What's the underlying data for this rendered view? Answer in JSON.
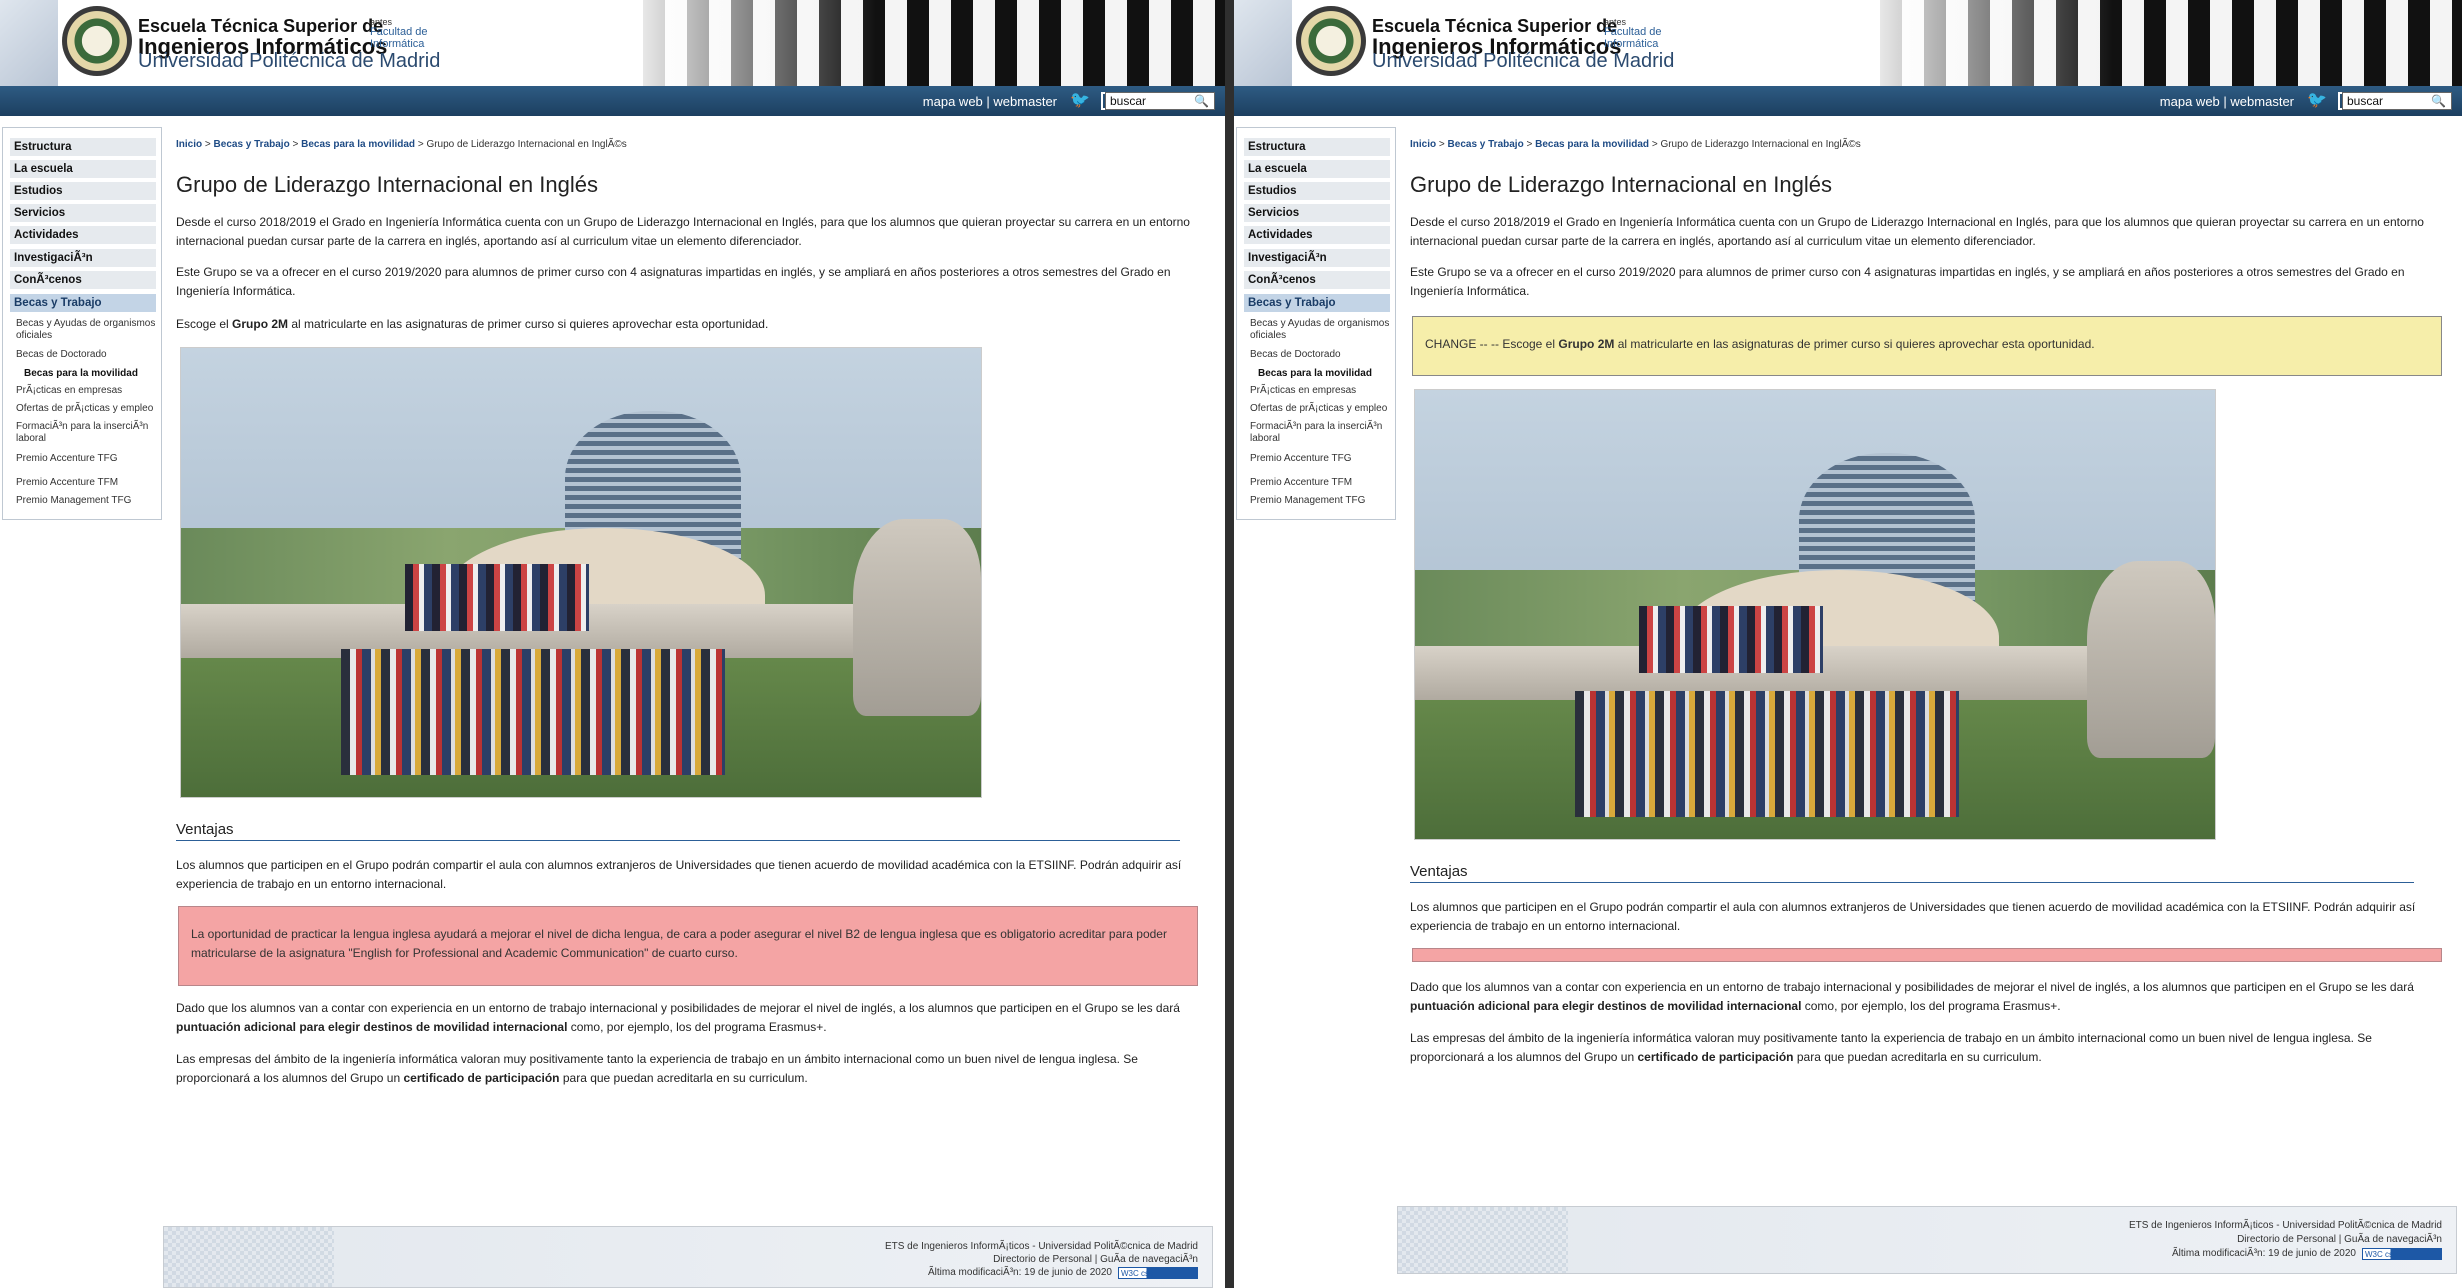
{
  "header": {
    "school_line1": "Escuela Técnica Superior de",
    "school_line2": "Ingenieros Informáticos",
    "university": "Universidad Politécnica de Madrid",
    "antes": "antes",
    "facultad_line1": "Facultad de",
    "facultad_line2": "Informática"
  },
  "topbar": {
    "mapa_web": "mapa web",
    "separator": "|",
    "webmaster": "webmaster",
    "search_value": "buscar"
  },
  "sidebar": {
    "items": [
      {
        "label": "Estructura"
      },
      {
        "label": "La escuela"
      },
      {
        "label": "Estudios"
      },
      {
        "label": "Servicios"
      },
      {
        "label": "Actividades"
      },
      {
        "label": "InvestigaciÃ³n"
      },
      {
        "label": "ConÃ³cenos"
      },
      {
        "label": "Becas y Trabajo"
      }
    ],
    "subitems": [
      {
        "label": "Becas y Ayudas de organismos oficiales"
      },
      {
        "label": "Becas de Doctorado"
      },
      {
        "label": "Becas para la movilidad"
      },
      {
        "label": "PrÃ¡cticas en empresas"
      },
      {
        "label": "Ofertas de prÃ¡cticas y empleo"
      },
      {
        "label": "FormaciÃ³n para la inserciÃ³n laboral"
      },
      {
        "label": "Premio Accenture TFG"
      },
      {
        "label": "Premio Accenture TFM"
      },
      {
        "label": "Premio Management TFG"
      }
    ]
  },
  "breadcrumb": {
    "inicio": "Inicio",
    "sep": ">",
    "becas_trabajo": "Becas y Trabajo",
    "becas_movilidad": "Becas para la movilidad",
    "current": "Grupo de Liderazgo Internacional en InglÃ©s"
  },
  "main": {
    "title": "Grupo de Liderazgo Internacional en Inglés",
    "p1": "Desde el curso 2018/2019 el Grado en Ingeniería Informática cuenta con un Grupo de Liderazgo Internacional en Inglés, para que los alumnos que quieran proyectar su carrera en un entorno internacional puedan cursar parte de la carrera en inglés,  aportando así al curriculum vitae un elemento diferenciador.",
    "p2": "Este Grupo se va a ofrecer en el curso 2019/2020 para alumnos de primer curso con 4 asignaturas impartidas en inglés, y se ampliará en años posteriores a otros semestres del Grado en Ingeniería Informática.",
    "p3_before": "Escoge el ",
    "p3_bold": "Grupo 2M",
    "p3_after": " al matricularte en las asignaturas de primer curso si quieres aprovechar esta oportunidad.",
    "change_prefix": "CHANGE -- -- Escoge el ",
    "ventajas": "Ventajas",
    "p4": "Los alumnos que participen en el Grupo podrán compartir el aula con alumnos extranjeros de Universidades que tienen acuerdo de movilidad académica con la ETSIINF. Podrán adquirir así experiencia de trabajo en un entorno internacional.",
    "red_box": "La oportunidad de practicar la lengua inglesa ayudará a mejorar el nivel de dicha lengua, de cara a poder asegurar el nivel B2 de lengua inglesa que es obligatorio acreditar para poder matricularse de la asignatura \"English for Professional and Academic Communication\" de cuarto curso.",
    "p5_before": "Dado que los alumnos van a contar con experiencia en un entorno de trabajo internacional y posibilidades de mejorar el nivel de inglés, a los alumnos que participen en el Grupo se les dará ",
    "p5_bold": "puntuación adicional para elegir destinos de movilidad internacional",
    "p5_after": " como, por ejemplo, los del programa Erasmus+.",
    "p6_before": "Las empresas del ámbito de la ingeniería informática valoran muy positivamente tanto la experiencia de trabajo en un ámbito internacional como un buen nivel de lengua inglesa. Se proporcionará a los alumnos del Grupo un ",
    "p6_bold": "certificado de participación",
    "p6_after": " para que puedan acreditarla en su curriculum."
  },
  "footer": {
    "line1": "ETS de Ingenieros InformÃ¡ticos   - Universidad PolitÃ©cnica de Madrid",
    "line2": "Directorio de Personal   | GuÃ­a de navegaciÃ³n",
    "line3": "Ãltima modificaciÃ³n: 19 de junio de 2020",
    "w3c": "W3C css"
  },
  "colors": {
    "topbar": "#1c3f60",
    "red_box": "#f4a4a4",
    "yellow_box": "#f6eeaa",
    "link": "#1e4b85"
  }
}
